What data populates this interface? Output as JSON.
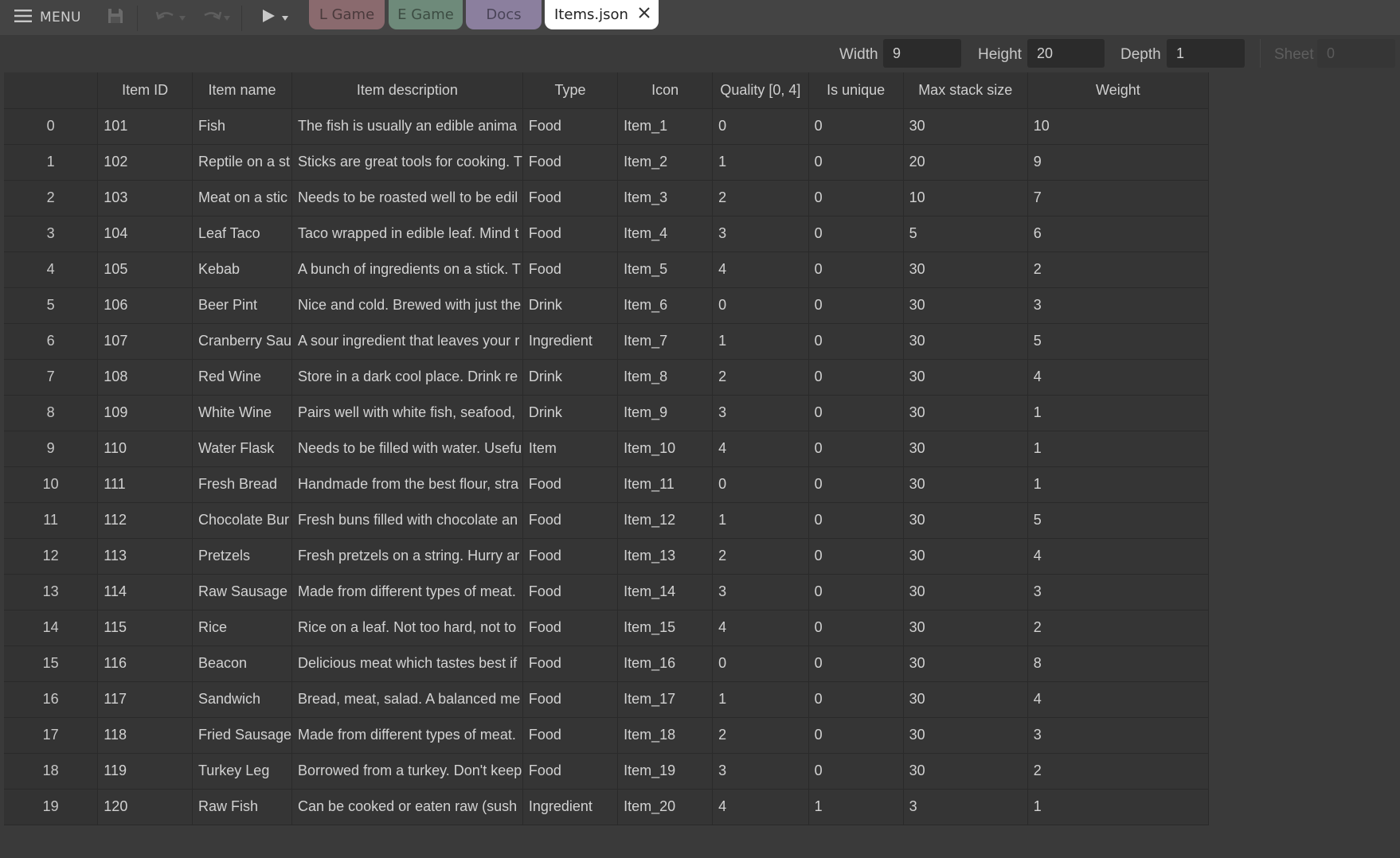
{
  "toolbar": {
    "menu_label": "MENU",
    "icons": [
      "hamburger-icon",
      "save-icon",
      "undo-icon",
      "redo-icon",
      "play-icon",
      "chevron-down-icon"
    ]
  },
  "tabs": [
    {
      "label": "L Game",
      "color": "#8a6a6e"
    },
    {
      "label": "E Game",
      "color": "#6e8a7a"
    },
    {
      "label": "Docs",
      "color": "#8b7f9e"
    },
    {
      "label": "Items.json",
      "active": true,
      "color": "#ffffff"
    }
  ],
  "dimensions": {
    "width_label": "Width",
    "width_value": "9",
    "height_label": "Height",
    "height_value": "20",
    "depth_label": "Depth",
    "depth_value": "1",
    "sheet_label": "Sheet",
    "sheet_value": "0"
  },
  "table": {
    "columns": [
      "Item ID",
      "Item name",
      "Item description",
      "Type",
      "Icon",
      "Quality [0, 4]",
      "Is unique",
      "Max stack size",
      "Weight"
    ],
    "rows": [
      [
        "0",
        "101",
        "Fish",
        "The fish is usually an edible anima",
        "Food",
        "Item_1",
        "0",
        "0",
        "30",
        "10"
      ],
      [
        "1",
        "102",
        "Reptile on a st",
        "Sticks are great tools for cooking. T",
        "Food",
        "Item_2",
        "1",
        "0",
        "20",
        "9"
      ],
      [
        "2",
        "103",
        "Meat on a stic",
        "Needs to be roasted well to be edil",
        "Food",
        "Item_3",
        "2",
        "0",
        "10",
        "7"
      ],
      [
        "3",
        "104",
        "Leaf Taco",
        "Taco wrapped in edible leaf. Mind t",
        "Food",
        "Item_4",
        "3",
        "0",
        "5",
        "6"
      ],
      [
        "4",
        "105",
        "Kebab",
        "A bunch of ingredients on a stick. T",
        "Food",
        "Item_5",
        "4",
        "0",
        "30",
        "2"
      ],
      [
        "5",
        "106",
        "Beer Pint",
        "Nice and cold. Brewed with just the",
        "Drink",
        "Item_6",
        "0",
        "0",
        "30",
        "3"
      ],
      [
        "6",
        "107",
        "Cranberry Sau",
        "A sour ingredient that leaves your r",
        "Ingredient",
        "Item_7",
        "1",
        "0",
        "30",
        "5"
      ],
      [
        "7",
        "108",
        "Red Wine",
        "Store in a dark cool place. Drink re",
        "Drink",
        "Item_8",
        "2",
        "0",
        "30",
        "4"
      ],
      [
        "8",
        "109",
        "White Wine",
        "Pairs well with white fish, seafood,",
        "Drink",
        "Item_9",
        "3",
        "0",
        "30",
        "1"
      ],
      [
        "9",
        "110",
        "Water Flask",
        "Needs to be filled with water. Usefu",
        "Item",
        "Item_10",
        "4",
        "0",
        "30",
        "1"
      ],
      [
        "10",
        "111",
        "Fresh Bread",
        "Handmade from the best flour, stra",
        "Food",
        "Item_11",
        "0",
        "0",
        "30",
        "1"
      ],
      [
        "11",
        "112",
        "Chocolate Bur",
        "Fresh buns filled with chocolate an",
        "Food",
        "Item_12",
        "1",
        "0",
        "30",
        "5"
      ],
      [
        "12",
        "113",
        "Pretzels",
        "Fresh pretzels on a string. Hurry ar",
        "Food",
        "Item_13",
        "2",
        "0",
        "30",
        "4"
      ],
      [
        "13",
        "114",
        "Raw Sausage",
        "Made from different types of meat.",
        "Food",
        "Item_14",
        "3",
        "0",
        "30",
        "3"
      ],
      [
        "14",
        "115",
        "Rice",
        "Rice on a leaf. Not too hard, not to",
        "Food",
        "Item_15",
        "4",
        "0",
        "30",
        "2"
      ],
      [
        "15",
        "116",
        "Beacon",
        "Delicious meat which tastes best if",
        "Food",
        "Item_16",
        "0",
        "0",
        "30",
        "8"
      ],
      [
        "16",
        "117",
        "Sandwich",
        "Bread, meat, salad. A balanced me",
        "Food",
        "Item_17",
        "1",
        "0",
        "30",
        "4"
      ],
      [
        "17",
        "118",
        "Fried Sausage",
        "Made from different types of meat.",
        "Food",
        "Item_18",
        "2",
        "0",
        "30",
        "3"
      ],
      [
        "18",
        "119",
        "Turkey Leg",
        "Borrowed from a turkey. Don't keep",
        "Food",
        "Item_19",
        "3",
        "0",
        "30",
        "2"
      ],
      [
        "19",
        "120",
        "Raw Fish",
        "Can be cooked or eaten raw (sush",
        "Ingredient",
        "Item_20",
        "4",
        "1",
        "3",
        "1"
      ]
    ]
  }
}
